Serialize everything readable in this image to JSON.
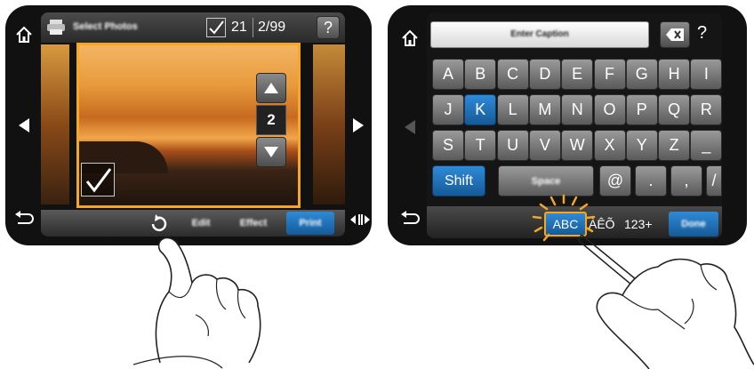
{
  "left": {
    "header": {
      "title": "Select Photos",
      "check_count": "21",
      "page_counter": "2/99",
      "help": "?"
    },
    "photo_stepper": {
      "value": "2"
    },
    "toolbar": {
      "edit": "Edit",
      "effect": "Effect",
      "print": "Print"
    }
  },
  "right": {
    "caption_field": {
      "placeholder": "Enter Caption"
    },
    "help": "?",
    "keyboard": {
      "row1": [
        "A",
        "B",
        "C",
        "D",
        "E",
        "F",
        "G",
        "H",
        "I"
      ],
      "row2": [
        "J",
        "K",
        "L",
        "M",
        "N",
        "O",
        "P",
        "Q",
        "R"
      ],
      "row3": [
        "S",
        "T",
        "U",
        "V",
        "W",
        "X",
        "Y",
        "Z",
        "_"
      ],
      "row4": {
        "shift": "Shift",
        "space": "Space",
        "at": "@",
        "dot": ".",
        "comma": ",",
        "slash": "/"
      },
      "bottom": {
        "abc": "ABC",
        "accents": "ÀÊÕ",
        "numbers": "123+",
        "done": "Done"
      }
    }
  },
  "colors": {
    "accent_orange": "#f5a623",
    "selected_blue": "#1a6fb5",
    "bezel": "#111111"
  },
  "icons": [
    "home-icon",
    "printer-icon",
    "check-icon",
    "help-icon",
    "arrow-up-icon",
    "arrow-down-icon",
    "arrow-left-icon",
    "arrow-right-icon",
    "back-icon",
    "rotate-icon",
    "play-pause-icon",
    "backspace-icon"
  ]
}
